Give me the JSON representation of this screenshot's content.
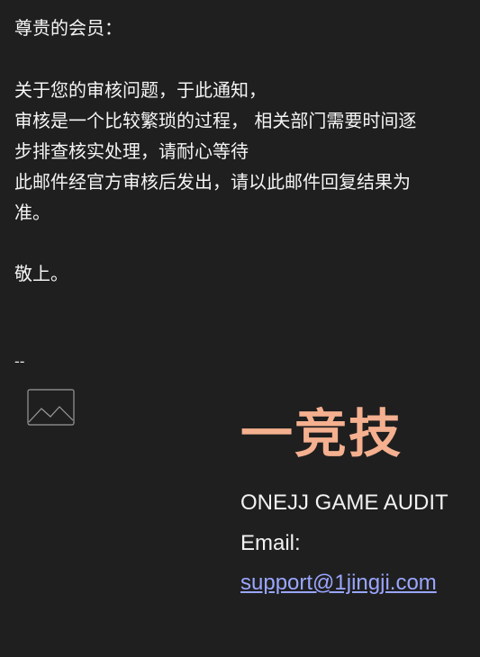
{
  "email": {
    "greeting": "尊贵的会员：",
    "body_lines": [
      "关于您的审核问题，于此通知，",
      "审核是一个比较繁琐的过程， 相关部门需要时间逐",
      "步排查核实处理，请耐心等待",
      "此邮件经官方审核后发出，请以此邮件回复结果为",
      "准。"
    ],
    "closing": "敬上。",
    "signature_separator": "--"
  },
  "signature": {
    "image_icon": "image-placeholder-icon",
    "brand_name": "一竞技",
    "company": "ONEJJ GAME AUDIT",
    "email_label": "Email:",
    "email_address": "support@1jingji.com",
    "brand_color": "#f4b08f",
    "link_color": "#9aa6ff"
  }
}
